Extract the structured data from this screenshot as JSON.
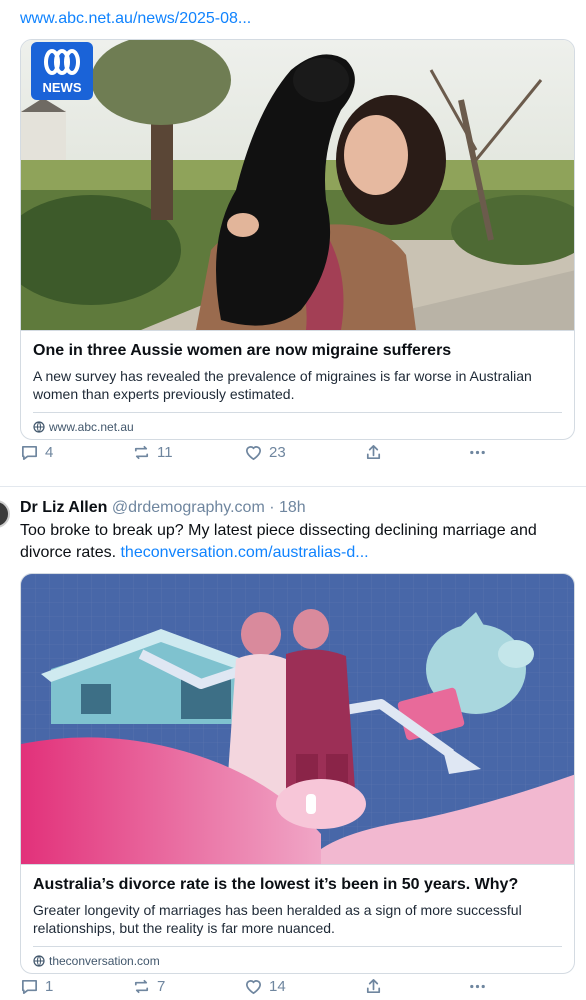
{
  "post1": {
    "link_text": "www.abc.net.au/news/2025-08...",
    "card": {
      "logo_text": "NEWS",
      "title": "One in three Aussie women are now migraine sufferers",
      "description": "A new survey has revealed the prevalence of migraines is far worse in Australian women than experts previously estimated.",
      "domain": "www.abc.net.au"
    },
    "actions": {
      "replies": "4",
      "reposts": "11",
      "likes": "23"
    }
  },
  "post2": {
    "author": "Dr Liz Allen",
    "handle": "@drdemography.com",
    "separator": " · ",
    "time": "18h",
    "text": "Too broke to break up? My latest piece dissecting declining marriage and divorce rates. ",
    "link": "theconversation.com/australias-d...",
    "card": {
      "title": "Australia’s divorce rate is the lowest it’s been in 50 years. Why?",
      "description": "Greater longevity of marriages has been heralded as a sign of more successful relationships, but the reality is far more nuanced.",
      "domain": "theconversation.com"
    },
    "actions": {
      "replies": "1",
      "reposts": "7",
      "likes": "14"
    }
  },
  "colors": {
    "link": "#1083fe",
    "muted": "#6f869f",
    "abc_blue": "#1a63d8"
  },
  "icons": [
    "reply-icon",
    "repost-icon",
    "like-icon",
    "share-icon",
    "more-icon",
    "globe-icon"
  ]
}
